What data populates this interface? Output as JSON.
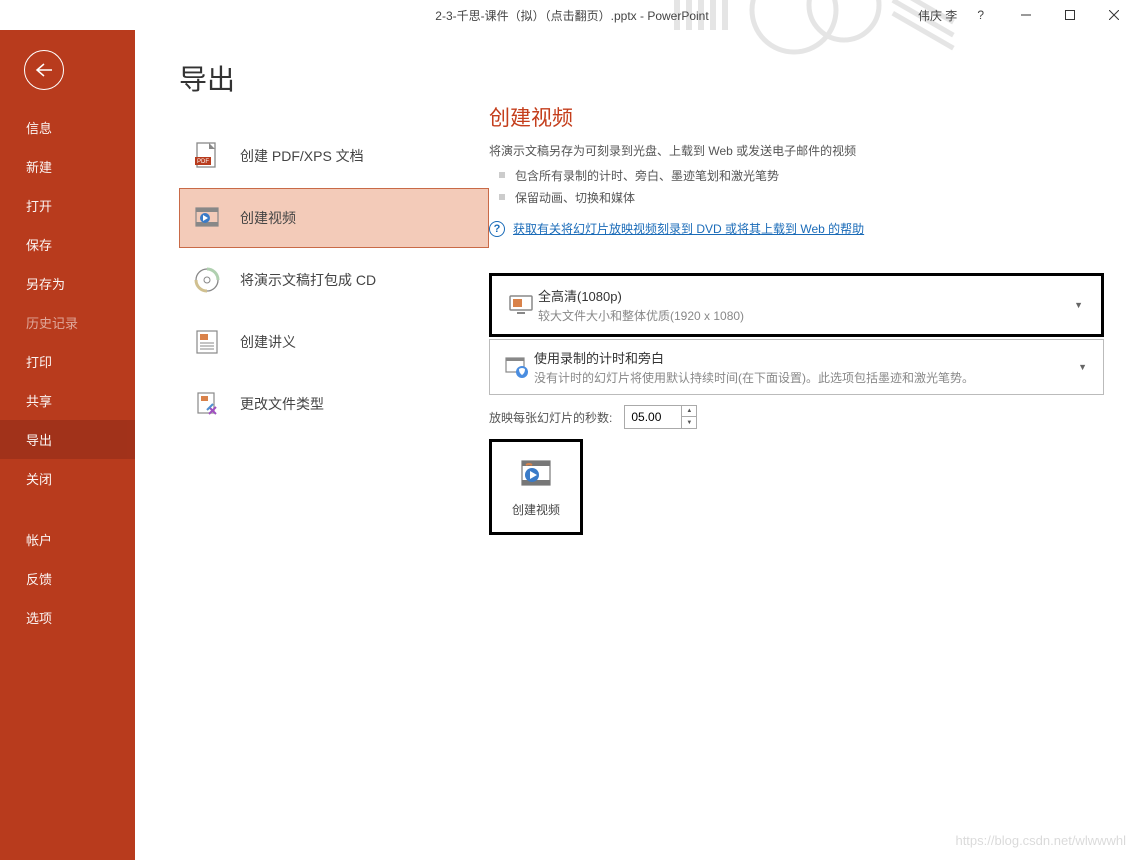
{
  "titlebar": {
    "title": "2-3-千思-课件（拟）（点击翻页）.pptx - PowerPoint",
    "user": "伟庆 李",
    "help": "?"
  },
  "sidebar": {
    "items": [
      {
        "label": "信息"
      },
      {
        "label": "新建"
      },
      {
        "label": "打开"
      },
      {
        "label": "保存"
      },
      {
        "label": "另存为"
      },
      {
        "label": "历史记录",
        "disabled": true
      },
      {
        "label": "打印"
      },
      {
        "label": "共享"
      },
      {
        "label": "导出",
        "active": true
      },
      {
        "label": "关闭"
      }
    ],
    "bottom": [
      {
        "label": "帐户"
      },
      {
        "label": "反馈"
      },
      {
        "label": "选项"
      }
    ]
  },
  "page": {
    "title": "导出"
  },
  "export_options": [
    {
      "label": "创建 PDF/XPS 文档",
      "icon": "pdf"
    },
    {
      "label": "创建视频",
      "icon": "video",
      "selected": true
    },
    {
      "label": "将演示文稿打包成 CD",
      "icon": "cd"
    },
    {
      "label": "创建讲义",
      "icon": "handout"
    },
    {
      "label": "更改文件类型",
      "icon": "filetype"
    }
  ],
  "detail": {
    "title": "创建视频",
    "desc": "将演示文稿另存为可刻录到光盘、上载到 Web 或发送电子邮件的视频",
    "bullets": [
      "包含所有录制的计时、旁白、墨迹笔划和激光笔势",
      "保留动画、切换和媒体"
    ],
    "help": "获取有关将幻灯片放映视频刻录到 DVD 或将其上载到 Web 的帮助",
    "quality": {
      "title": "全高清(1080p)",
      "sub": "较大文件大小和整体优质(1920 x 1080)"
    },
    "timing": {
      "title": "使用录制的计时和旁白",
      "sub": "没有计时的幻灯片将使用默认持续时间(在下面设置)。此选项包括墨迹和激光笔势。"
    },
    "seconds_label": "放映每张幻灯片的秒数:",
    "seconds_value": "05.00",
    "create_btn": "创建视频"
  },
  "watermark": "https://blog.csdn.net/wlwwwhl"
}
